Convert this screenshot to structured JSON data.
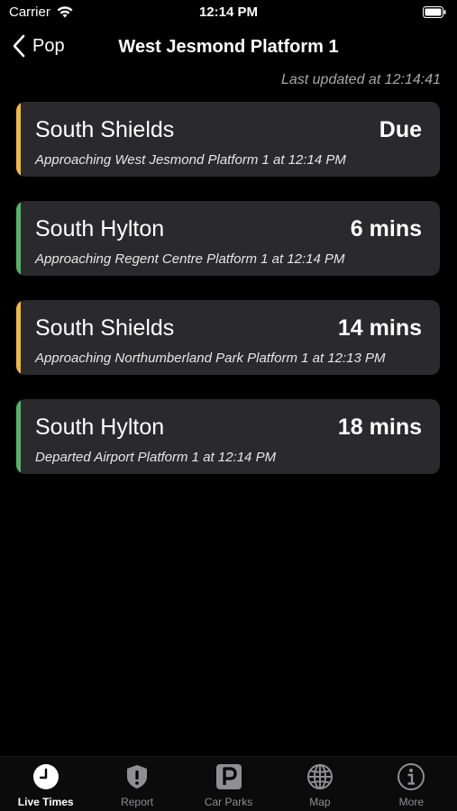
{
  "status_bar": {
    "carrier": "Carrier",
    "time": "12:14 PM"
  },
  "nav": {
    "back_label": "Pop",
    "title": "West Jesmond Platform 1"
  },
  "last_updated": "Last updated at 12:14:41",
  "departures": [
    {
      "destination": "South Shields",
      "eta": "Due",
      "status": "Approaching West Jesmond Platform 1 at 12:14 PM",
      "accent_color": "#f4b73f"
    },
    {
      "destination": "South Hylton",
      "eta": "6 mins",
      "status": "Approaching Regent Centre Platform 1 at 12:14 PM",
      "accent_color": "#53b564"
    },
    {
      "destination": "South Shields",
      "eta": "14 mins",
      "status": "Approaching Northumberland Park Platform 1 at 12:13 PM",
      "accent_color": "#f4b73f"
    },
    {
      "destination": "South Hylton",
      "eta": "18 mins",
      "status": "Departed Airport Platform 1 at 12:14 PM",
      "accent_color": "#53b564"
    }
  ],
  "tabs": [
    {
      "label": "Live Times",
      "icon": "clock-icon",
      "active": true
    },
    {
      "label": "Report",
      "icon": "report-icon",
      "active": false
    },
    {
      "label": "Car Parks",
      "icon": "parking-icon",
      "active": false
    },
    {
      "label": "Map",
      "icon": "globe-icon",
      "active": false
    },
    {
      "label": "More",
      "icon": "info-icon",
      "active": false
    }
  ],
  "colors": {
    "background": "#000000",
    "card_background": "#2a2a2c",
    "line_yellow": "#f4b73f",
    "line_green": "#53b564",
    "tab_inactive": "#8e8e93"
  }
}
